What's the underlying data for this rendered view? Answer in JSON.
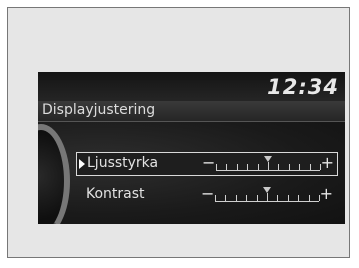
{
  "display": {
    "clock": "12:34",
    "title": "Displayjustering"
  },
  "menu": {
    "items": [
      {
        "label": "Ljusstyrka",
        "selected": true,
        "minus": "−",
        "plus": "+",
        "level": 0.5
      },
      {
        "label": "Kontrast",
        "selected": false,
        "minus": "−",
        "plus": "+",
        "level": 0.5
      }
    ]
  },
  "colors": {
    "screen_bg": "#0c0c0c",
    "text": "#e2e2e2",
    "selection_border": "#d9d9d9"
  },
  "icons": {
    "selection": "selection-arrow-icon",
    "knob": "dial-knob-icon"
  }
}
